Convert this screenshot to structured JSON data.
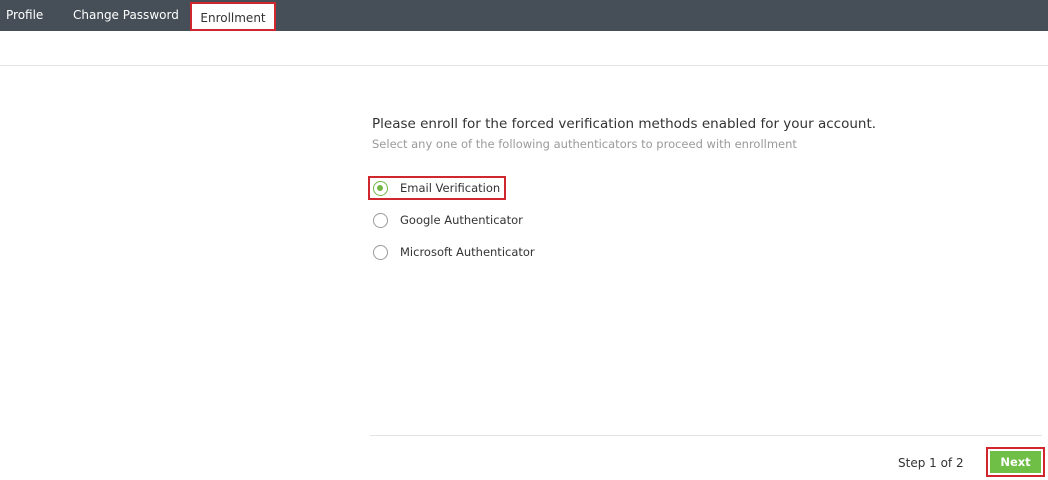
{
  "tabs": [
    {
      "label": "Profile"
    },
    {
      "label": "Change Password"
    },
    {
      "label": "Enrollment",
      "active": true
    }
  ],
  "main": {
    "heading": "Please enroll for the forced verification methods enabled for your account.",
    "subheading": "Select any one of the following authenticators to proceed with enrollment",
    "options": [
      {
        "label": "Email Verification",
        "selected": true
      },
      {
        "label": "Google Authenticator",
        "selected": false
      },
      {
        "label": "Microsoft Authenticator",
        "selected": false
      }
    ]
  },
  "footer": {
    "step_text": "Step 1 of 2",
    "next_label": "Next"
  },
  "colors": {
    "topbar": "#464f57",
    "accent_green": "#72b744",
    "button_green": "#6fbf47",
    "highlight_red": "#d0262d"
  }
}
